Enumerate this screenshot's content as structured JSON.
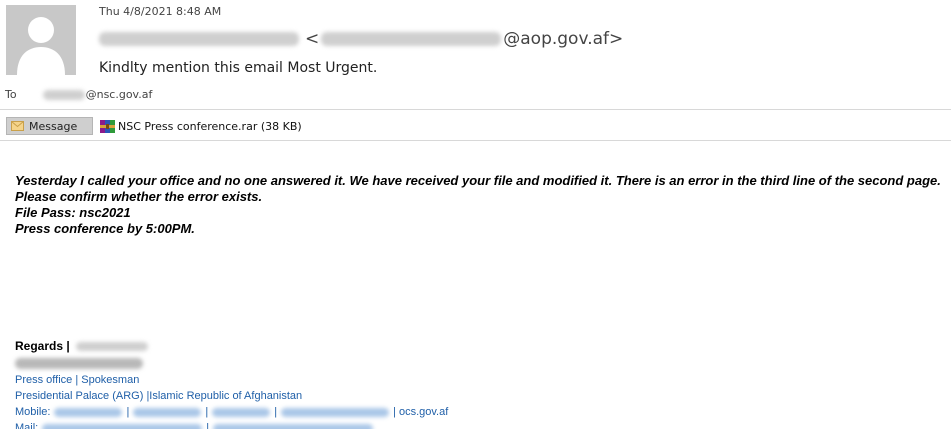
{
  "header": {
    "date": "Thu 4/8/2021 8:48 AM",
    "from_bracket_open": "<",
    "from_domain": "@aop.gov.af>",
    "subject": "Kindlty mention this email Most Urgent.",
    "to_label": "To",
    "to_domain": "@nsc.gov.af"
  },
  "tabs": {
    "message_label": "Message",
    "attachment_label": "NSC Press conference.rar (38 KB)"
  },
  "body": {
    "lines": [
      "Yesterday I called your office and no one answered it. We have received your file and modified it. There is an error in the third line of the second page.",
      "Please confirm whether the error exists.",
      "File Pass: nsc2021",
      "Press conference by 5:00PM."
    ]
  },
  "signature": {
    "regards": "Regards |",
    "office": "Press office | Spokesman",
    "palace": "Presidential Palace (ARG) |Islamic Republic of Afghanistan",
    "mobile_label": "Mobile:",
    "site": "| ocs.gov.af",
    "mail_label": "Mail:"
  },
  "colors": {
    "link_blue": "#1f5fa8",
    "avatar_bg": "#c8c8c8",
    "tab_bg": "#cfcfcf"
  }
}
